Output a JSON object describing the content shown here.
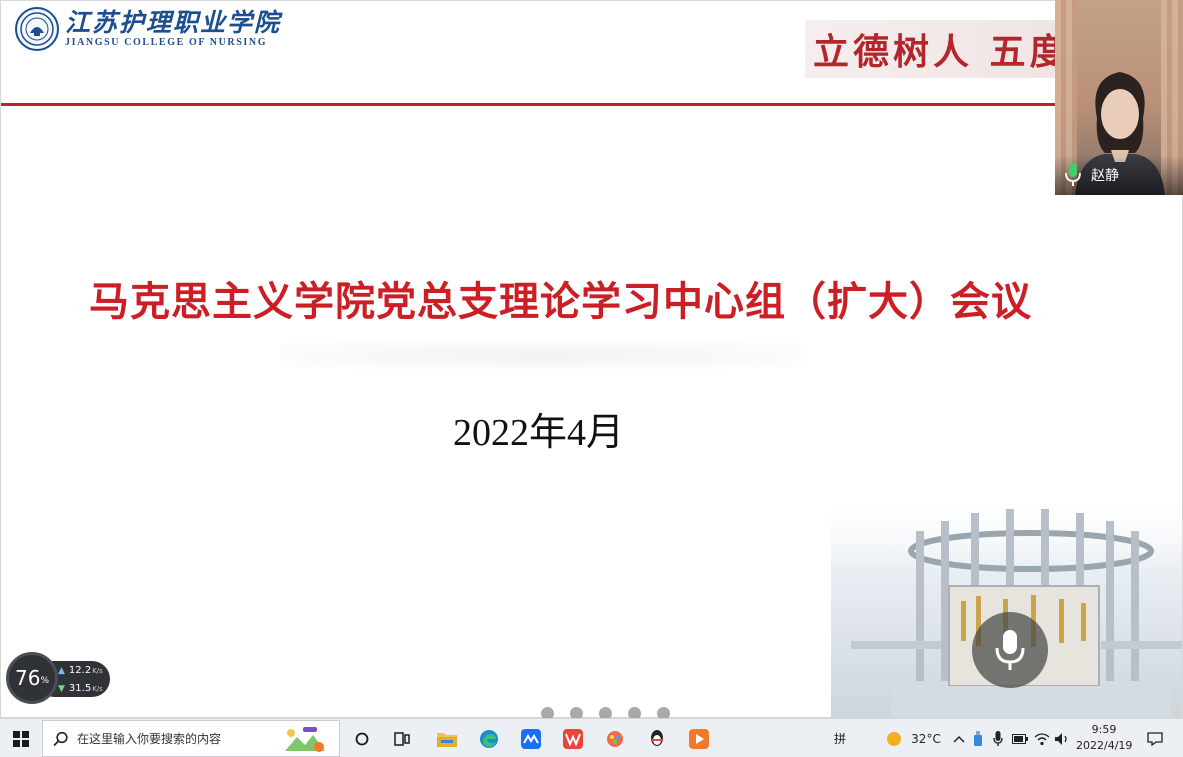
{
  "slide": {
    "logo_cn": "江苏护理职业学院",
    "logo_en": "JIANGSU COLLEGE OF NURSING",
    "motto": "立德树人 五度",
    "title": "马克思主义学院党总支理论学习中心组（扩大）会议",
    "date": "2022年4月"
  },
  "video": {
    "speaker_name": "赵静"
  },
  "perf_widget": {
    "cpu_value": "76",
    "cpu_unit": "%",
    "upload_value": "12.2",
    "upload_unit": "K/s",
    "download_value": "31.5",
    "download_unit": "K/s"
  },
  "pager": {
    "count": 5
  },
  "taskbar": {
    "search_placeholder": "在这里输入你要搜索的内容",
    "ime": "拼",
    "weather": "32°C",
    "time": "9:59",
    "date": "2022/4/19"
  },
  "colors": {
    "accent_red": "#cc1f25",
    "brand_blue": "#1c4f8f",
    "rule_red": "#b3262b"
  },
  "icons": {
    "start": "windows-logo-icon",
    "search": "search-icon",
    "task_view": "task-view-icon",
    "explorer": "file-explorer-icon",
    "edge": "edge-browser-icon",
    "meeting": "tencent-meeting-icon",
    "wps": "wps-office-icon",
    "app_paint": "paint-app-icon",
    "app_penguin": "qq-icon",
    "app_video": "video-player-icon",
    "mic": "microphone-icon",
    "notification": "notification-icon"
  }
}
